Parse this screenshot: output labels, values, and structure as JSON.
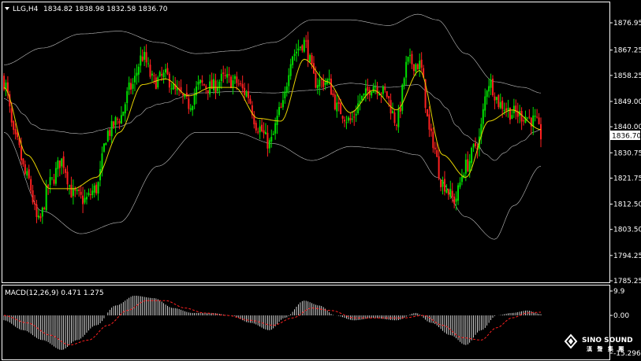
{
  "header": {
    "symbol_timeframe": "LLG,H4",
    "ohlc": "1834.82 1838.98 1832.58 1836.70",
    "indicator": "MACD(12,26,9) 0.471 1.275"
  },
  "colors": {
    "background": "#000000",
    "bull": "#00e000",
    "bear": "#ff2020",
    "bollinger": "#c0c0c0",
    "ma": "#e6d200",
    "macd_hist": "#ffffff",
    "signal": "#ff2020",
    "price_tag_bg": "#ffffff",
    "price_tag_fg": "#000000"
  },
  "current_price": "1836.70",
  "logo": {
    "brand": "SINO SOUND",
    "subtitle": "漢 聲 集 團"
  },
  "chart_data": [
    {
      "type": "candlestick",
      "title": "",
      "ylim": [
        1785.25,
        1880.0
      ],
      "y_ticks": [
        "1876.95",
        "1867.25",
        "1858.25",
        "1849.00",
        "1840.00",
        "1830.75",
        "1821.75",
        "1812.50",
        "1803.50",
        "1794.25",
        "1785.25"
      ],
      "y_tick_values": [
        1876.95,
        1867.25,
        1858.25,
        1849.0,
        1840.0,
        1830.75,
        1821.75,
        1812.5,
        1803.5,
        1794.25,
        1785.25
      ],
      "grid": false,
      "anchors_close": [
        [
          0,
          1856
        ],
        [
          6,
          1835
        ],
        [
          12,
          1822
        ],
        [
          18,
          1806
        ],
        [
          24,
          1820
        ],
        [
          30,
          1828
        ],
        [
          36,
          1816
        ],
        [
          42,
          1814
        ],
        [
          48,
          1818
        ],
        [
          54,
          1838
        ],
        [
          60,
          1843
        ],
        [
          66,
          1854
        ],
        [
          72,
          1865
        ],
        [
          78,
          1856
        ],
        [
          84,
          1858
        ],
        [
          90,
          1852
        ],
        [
          96,
          1848
        ],
        [
          102,
          1855
        ],
        [
          108,
          1854
        ],
        [
          114,
          1857
        ],
        [
          120,
          1856
        ],
        [
          126,
          1852
        ],
        [
          132,
          1840
        ],
        [
          138,
          1834
        ],
        [
          144,
          1846
        ],
        [
          150,
          1866
        ],
        [
          156,
          1870
        ],
        [
          162,
          1856
        ],
        [
          168,
          1856
        ],
        [
          174,
          1846
        ],
        [
          180,
          1842
        ],
        [
          186,
          1850
        ],
        [
          192,
          1855
        ],
        [
          198,
          1852
        ],
        [
          204,
          1842
        ],
        [
          210,
          1863
        ],
        [
          216,
          1862
        ],
        [
          222,
          1836
        ],
        [
          228,
          1820
        ],
        [
          234,
          1814
        ],
        [
          240,
          1826
        ],
        [
          246,
          1834
        ],
        [
          252,
          1856
        ],
        [
          258,
          1848
        ],
        [
          264,
          1845
        ],
        [
          270,
          1844
        ],
        [
          276,
          1842
        ],
        [
          279,
          1837
        ]
      ],
      "bb_upper": [
        [
          0,
          1862
        ],
        [
          20,
          1868
        ],
        [
          40,
          1873
        ],
        [
          60,
          1874
        ],
        [
          80,
          1870
        ],
        [
          100,
          1866
        ],
        [
          120,
          1867
        ],
        [
          140,
          1870
        ],
        [
          160,
          1878
        ],
        [
          180,
          1878
        ],
        [
          200,
          1876
        ],
        [
          215,
          1880
        ],
        [
          225,
          1878
        ],
        [
          240,
          1866
        ],
        [
          255,
          1856
        ],
        [
          270,
          1854
        ],
        [
          279,
          1852
        ]
      ],
      "bb_lower": [
        [
          0,
          1838
        ],
        [
          20,
          1810
        ],
        [
          40,
          1802
        ],
        [
          60,
          1806
        ],
        [
          80,
          1826
        ],
        [
          100,
          1838
        ],
        [
          120,
          1838
        ],
        [
          140,
          1834
        ],
        [
          160,
          1828
        ],
        [
          180,
          1833
        ],
        [
          200,
          1832
        ],
        [
          215,
          1830
        ],
        [
          225,
          1822
        ],
        [
          240,
          1808
        ],
        [
          255,
          1800
        ],
        [
          265,
          1812
        ],
        [
          279,
          1826
        ]
      ],
      "ma": [
        [
          0,
          1854
        ],
        [
          12,
          1830
        ],
        [
          24,
          1818
        ],
        [
          36,
          1818
        ],
        [
          48,
          1822
        ],
        [
          60,
          1838
        ],
        [
          72,
          1855
        ],
        [
          84,
          1857
        ],
        [
          96,
          1851
        ],
        [
          108,
          1854
        ],
        [
          120,
          1854
        ],
        [
          132,
          1843
        ],
        [
          144,
          1842
        ],
        [
          156,
          1864
        ],
        [
          168,
          1856
        ],
        [
          180,
          1845
        ],
        [
          192,
          1853
        ],
        [
          204,
          1846
        ],
        [
          216,
          1860
        ],
        [
          228,
          1830
        ],
        [
          240,
          1822
        ],
        [
          252,
          1842
        ],
        [
          264,
          1846
        ],
        [
          279,
          1839
        ]
      ]
    },
    {
      "type": "bar",
      "title": "MACD(12,26,9)",
      "ylim": [
        -15.296,
        9.9
      ],
      "y_ticks": [
        "9.9",
        "0.00",
        "-15.296"
      ],
      "y_tick_values": [
        9.9,
        0.0,
        -15.296
      ],
      "macd_anchors": [
        [
          0,
          -2
        ],
        [
          10,
          -6
        ],
        [
          20,
          -10
        ],
        [
          30,
          -14
        ],
        [
          38,
          -10
        ],
        [
          48,
          -4
        ],
        [
          58,
          4
        ],
        [
          68,
          8
        ],
        [
          78,
          7
        ],
        [
          88,
          3
        ],
        [
          98,
          1
        ],
        [
          108,
          1
        ],
        [
          118,
          0
        ],
        [
          128,
          -3
        ],
        [
          138,
          -6
        ],
        [
          146,
          -1
        ],
        [
          156,
          6
        ],
        [
          164,
          4
        ],
        [
          172,
          0
        ],
        [
          182,
          -2
        ],
        [
          192,
          -1
        ],
        [
          204,
          -2
        ],
        [
          214,
          1
        ],
        [
          222,
          -3
        ],
        [
          232,
          -8
        ],
        [
          240,
          -12
        ],
        [
          248,
          -6
        ],
        [
          256,
          0
        ],
        [
          264,
          1
        ],
        [
          272,
          2
        ],
        [
          279,
          0.5
        ]
      ],
      "signal_anchors": [
        [
          0,
          0
        ],
        [
          12,
          -3
        ],
        [
          24,
          -8
        ],
        [
          34,
          -12
        ],
        [
          44,
          -10
        ],
        [
          54,
          -4
        ],
        [
          64,
          2
        ],
        [
          74,
          6
        ],
        [
          84,
          6
        ],
        [
          94,
          3
        ],
        [
          104,
          1
        ],
        [
          116,
          0
        ],
        [
          128,
          -2
        ],
        [
          140,
          -4
        ],
        [
          150,
          -1
        ],
        [
          160,
          3
        ],
        [
          170,
          2
        ],
        [
          182,
          -1
        ],
        [
          196,
          -1
        ],
        [
          208,
          -1
        ],
        [
          218,
          0
        ],
        [
          228,
          -4
        ],
        [
          238,
          -9
        ],
        [
          248,
          -10
        ],
        [
          256,
          -5
        ],
        [
          264,
          -1
        ],
        [
          272,
          1
        ],
        [
          279,
          1.3
        ]
      ]
    }
  ]
}
